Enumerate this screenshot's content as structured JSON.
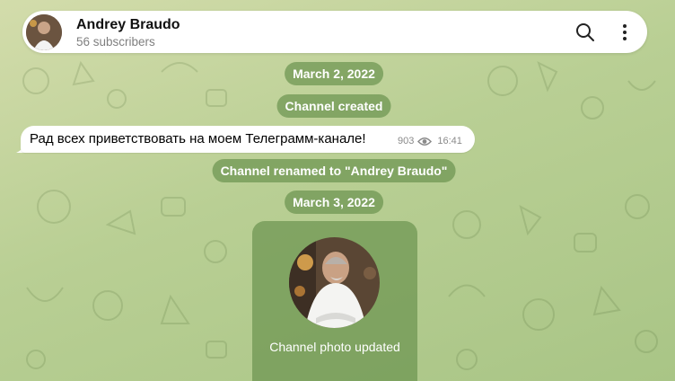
{
  "header": {
    "title": "Andrey Braudo",
    "subtitle": "56 subscribers",
    "avatar_icon": "channel-avatar",
    "search_icon": "search-icon",
    "menu_icon": "more-vertical-icon"
  },
  "service": {
    "date1": "March 2, 2022",
    "created": "Channel created",
    "renamed": "Channel renamed to \"Andrey Braudo\"",
    "date2": "March 3, 2022",
    "photo_updated": "Channel photo updated"
  },
  "message": {
    "text": "Рад всех приветствовать на моем Телеграмм-канале!",
    "views": "903",
    "time": "16:41",
    "views_icon": "eye-icon"
  },
  "colors": {
    "pill_bg": "#6c9450",
    "header_bg": "#ffffff",
    "background": "#c4d59f"
  }
}
